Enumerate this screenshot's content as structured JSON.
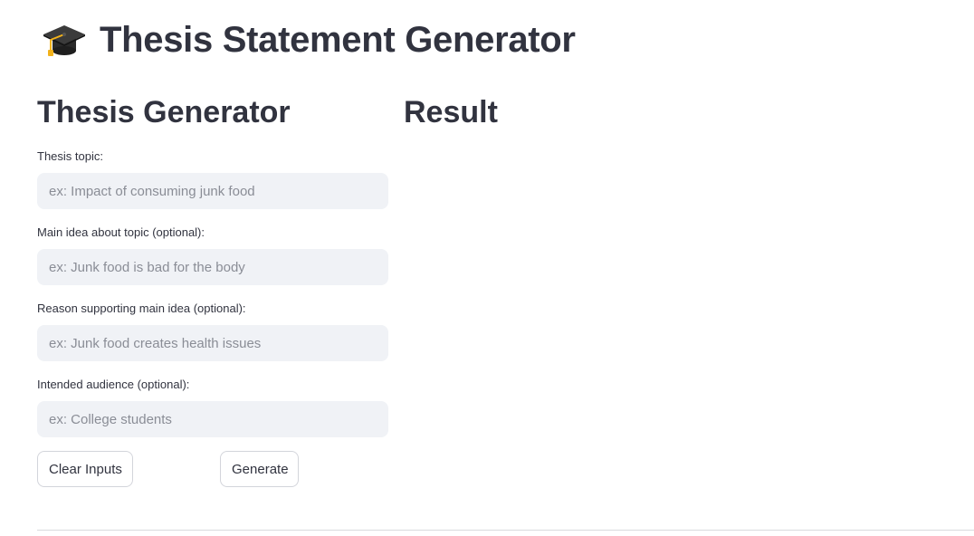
{
  "app": {
    "title": "Thesis Statement Generator",
    "icon": "graduation-cap-icon"
  },
  "generator": {
    "heading": "Thesis Generator",
    "fields": [
      {
        "label": "Thesis topic:",
        "value": "",
        "placeholder": "ex: Impact of consuming junk food"
      },
      {
        "label": "Main idea about topic (optional):",
        "value": "",
        "placeholder": "ex: Junk food is bad for the body"
      },
      {
        "label": "Reason supporting main idea (optional):",
        "value": "",
        "placeholder": "ex: Junk food creates health issues"
      },
      {
        "label": "Intended audience (optional):",
        "value": "",
        "placeholder": "ex: College students"
      }
    ],
    "buttons": {
      "clear_label": "Clear Inputs",
      "generate_label": "Generate"
    }
  },
  "result": {
    "heading": "Result"
  },
  "colors": {
    "text": "#31333f",
    "input_bg": "#f0f2f6",
    "button_border": "#d3d5db",
    "divider": "#d9dadd"
  }
}
